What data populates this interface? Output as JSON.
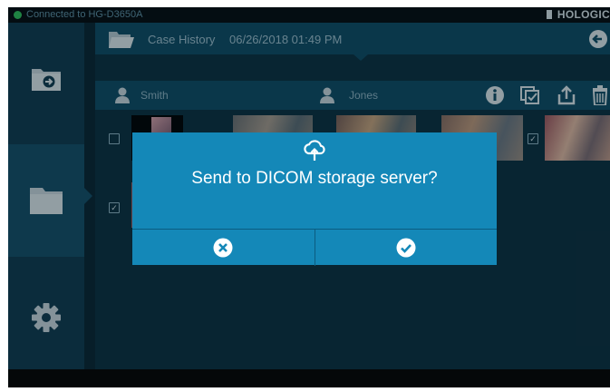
{
  "status_bar": {
    "connection_text": "Connected to HG-D3650A",
    "brand": "HOLOGIC",
    "connection_color": "#2fbf58"
  },
  "sidebar": {
    "items": [
      {
        "icon": "folder-import-icon"
      },
      {
        "icon": "folder-icon",
        "active": true
      },
      {
        "icon": "gear-icon"
      }
    ]
  },
  "header": {
    "title": "Case History",
    "datetime": "06/26/2018 01:49 PM"
  },
  "people": {
    "left_name": "Smith",
    "right_name": "Jones"
  },
  "thumbnails": [
    {
      "checked": false
    },
    {
      "checked": true
    },
    {
      "checked": true
    },
    {
      "checked": true
    },
    {
      "checked": true
    },
    {
      "checked": true
    }
  ],
  "dialog": {
    "title": "Send to DICOM storage server?",
    "cancel_icon": "close-circle-icon",
    "confirm_icon": "check-circle-icon",
    "accent": "#1488b8"
  }
}
